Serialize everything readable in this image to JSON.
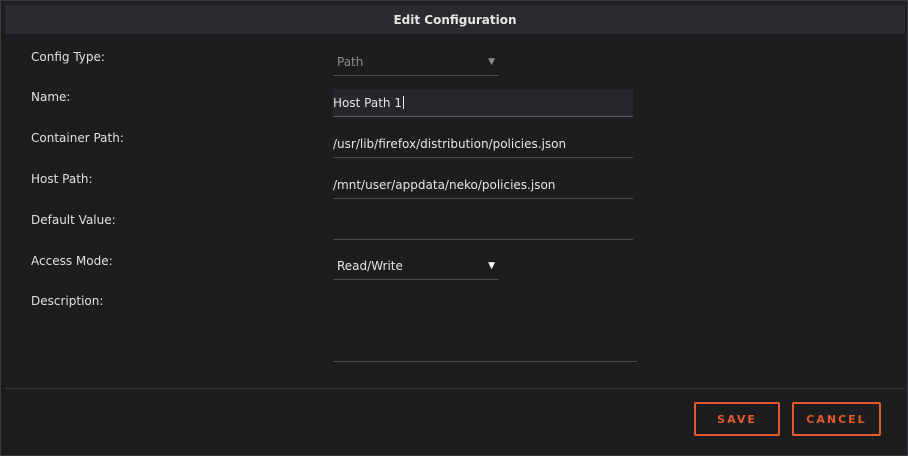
{
  "dialog": {
    "title": "Edit Configuration"
  },
  "form": {
    "config_type": {
      "label": "Config Type:",
      "value": "Path"
    },
    "name": {
      "label": "Name:",
      "value": "Host Path 1"
    },
    "container_path": {
      "label": "Container Path:",
      "value": "/usr/lib/firefox/distribution/policies.json"
    },
    "host_path": {
      "label": "Host Path:",
      "value": "/mnt/user/appdata/neko/policies.json"
    },
    "default_value": {
      "label": "Default Value:",
      "value": ""
    },
    "access_mode": {
      "label": "Access Mode:",
      "value": "Read/Write"
    },
    "description": {
      "label": "Description:",
      "value": ""
    },
    "dropdown_arrow": "▼"
  },
  "buttons": {
    "save": "SAVE",
    "cancel": "CANCEL"
  },
  "colors": {
    "accent": "#e45a2a",
    "background": "#1c1d1f",
    "titlebar": "#2a2b2e"
  }
}
